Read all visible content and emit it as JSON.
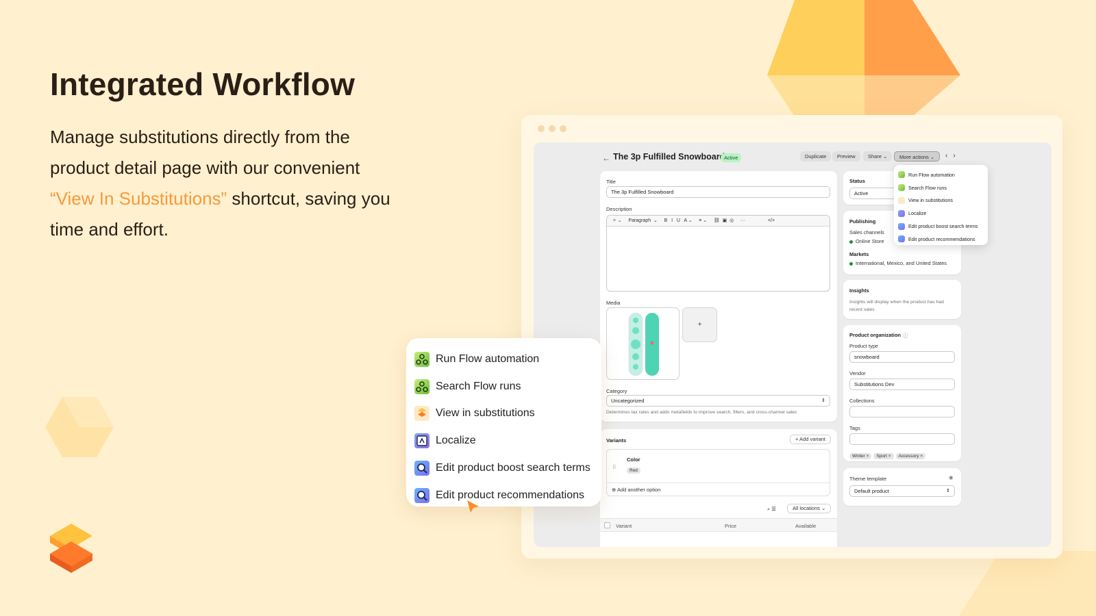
{
  "headline": "Integrated Workflow",
  "lead": {
    "part1": "Manage substitutions directly from the product detail page with our convenient ",
    "highlight": "“View In Substitutions”",
    "part2": " shortcut, saving you time and effort."
  },
  "colors": {
    "background": "#fff0cf",
    "accent": "#f59a3c",
    "active_badge": "#b9f2c4"
  },
  "product_page": {
    "title": "The 3p Fulfilled Snowboard",
    "status_badge": "Active",
    "toolbar": {
      "duplicate": "Duplicate",
      "preview": "Preview",
      "share": "Share ⌄",
      "more_actions": "More actions ⌄"
    },
    "title_label": "Title",
    "title_value": "The 3p Fulfilled Snowboard",
    "description_label": "Description",
    "editor_toolbar": "✧ ⌄     Paragraph  ⌄     B   I   U   A ⌄     ≡ ⌄     ⛓  ▣  ◎     ···                 </>",
    "media_label": "Media",
    "media_add": "+",
    "category_label": "Category",
    "category_value": "Uncategorized",
    "category_help": "Determines tax rates and adds metafields to improve search, filters, and cross-channel sales",
    "variants_label": "Variants",
    "add_variant": "+ Add variant",
    "option_name": "Color",
    "option_value": "Red",
    "add_option": "⊕ Add another option",
    "locations": "All locations ⌄",
    "table_headers": {
      "variant": "Variant",
      "price": "Price",
      "available": "Available"
    },
    "status_label": "Status",
    "status_value": "Active",
    "publishing_label": "Publishing",
    "sales_channels_label": "Sales channels",
    "sales_channel": "Online Store",
    "markets_label": "Markets",
    "markets_value": "International, Mexico, and United States",
    "insights_label": "Insights",
    "insights_text": "Insights will display when the product has had recent sales",
    "org_label": "Product organization",
    "product_type_label": "Product type",
    "product_type_value": "snowboard",
    "vendor_label": "Vendor",
    "vendor_value": "Substitutions Dev",
    "collections_label": "Collections",
    "tags_label": "Tags",
    "tags": [
      "Winter",
      "Sport",
      "Accessory"
    ],
    "theme_label": "Theme template",
    "theme_value": "Default product"
  },
  "more_actions_menu": [
    {
      "label": "Run Flow automation",
      "icon": "flow-icon"
    },
    {
      "label": "Search Flow runs",
      "icon": "flow-icon"
    },
    {
      "label": "View in substitutions",
      "icon": "substitutions-icon"
    },
    {
      "label": "Localize",
      "icon": "localize-icon"
    },
    {
      "label": "Edit product boost search terms",
      "icon": "search-boost-icon"
    },
    {
      "label": "Edit product recommendations",
      "icon": "search-boost-icon"
    }
  ]
}
